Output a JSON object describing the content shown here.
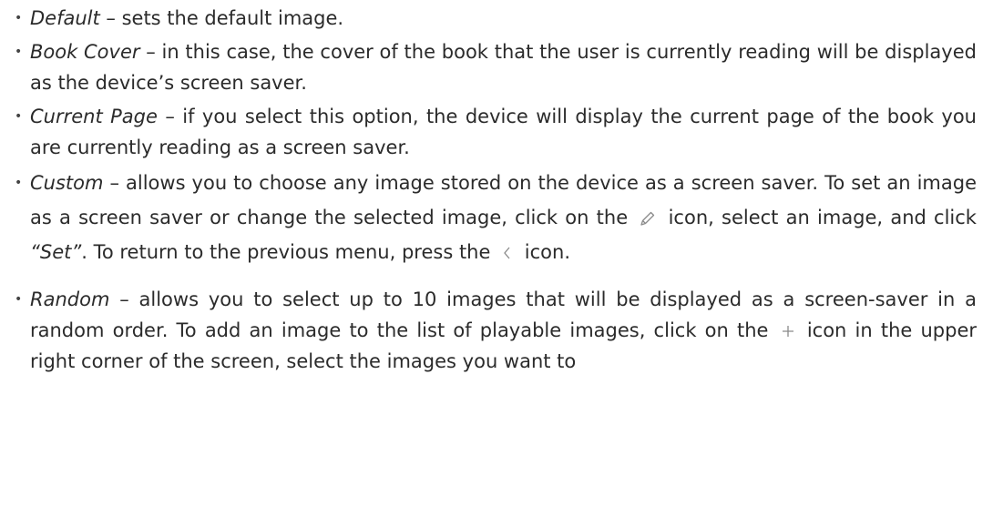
{
  "items": [
    {
      "term": "Default",
      "text": " – sets the default image."
    },
    {
      "term": "Book Cover",
      "text": " – in this case, the cover of the book that the user is currently reading will be displayed as the device’s screen saver."
    },
    {
      "term": "Current Page",
      "text": " – if you select this option, the device will display the current page of the book you are currently reading as a screen saver."
    },
    {
      "term": "Custom",
      "text_a": " – allows you to choose any image stored on the device as a screen saver. To set an image as a screen saver or change the selected image, click on the",
      "text_b": "icon, select an image, and click ",
      "set_label": "“Set”",
      "text_c": ". To return to the previous menu, press the",
      "text_d": " icon."
    },
    {
      "term": "Random",
      "text_a": " – allows you to select up to 10 images that will be displayed as a screen-saver in a random order. To add an image to the list of playable images, click on the",
      "text_b": " icon in the upper right corner of the screen, select the images you want to"
    }
  ],
  "icons": [
    "pencil-icon",
    "chevron-left-icon",
    "plus-icon"
  ],
  "colors": {
    "text": "#2b2b2b",
    "icon": "#8a8a8a"
  }
}
